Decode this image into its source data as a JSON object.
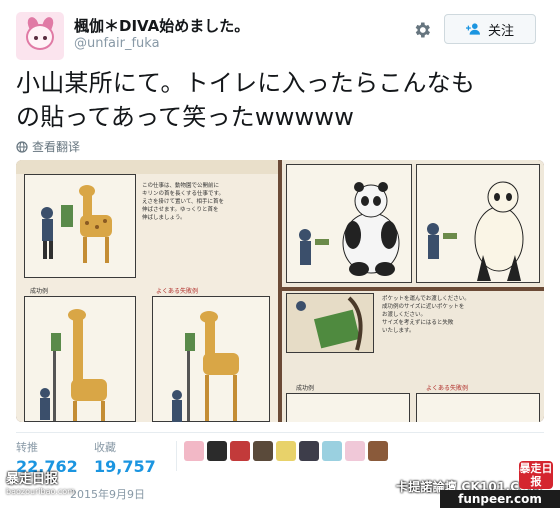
{
  "user": {
    "display_name": "楓伽＊DIVA始めました。",
    "handle": "@unfair_fuka"
  },
  "actions": {
    "follow_label": "关注",
    "settings_icon": "gear-icon",
    "follow_icon": "person-add-icon"
  },
  "tweet": {
    "text": "小山某所にて。トイレに入ったらこんなものの貼ってあって笑ったwwwww",
    "line1": "小山某所にて。トイレに入ったらこんなも",
    "line2": "の貼ってあって笑ったwwwww",
    "translate_label": "查看翻译"
  },
  "media": {
    "poster_lines": [
      "この仕事は、動物園で公開前に",
      "キリンの首を長くする仕事です。",
      "えさを掛けて置いて、相手に首を",
      "伸ばさせます。ゆっくりと首を",
      "伸ばしましょう。"
    ],
    "ok_label": "成功例",
    "ng_label": "よくある失敗例",
    "rb_lines": [
      "ポケットを運んでお渡しください。",
      "成功例のサイズに近いポケットを",
      "お渡しください。",
      "サイズを考えずにはると失敗",
      "いたします。"
    ]
  },
  "stats": {
    "retweets_label": "转推",
    "retweets_value": "22,762",
    "likes_label": "收藏",
    "likes_value": "19,757"
  },
  "likers": [
    "#f2b8c6",
    "#2b2b2b",
    "#c23a3a",
    "#5a4a3a",
    "#e8d26a",
    "#3d3d4a",
    "#9ad0e0",
    "#f0c8d8",
    "#8a5a3a"
  ],
  "timestamp": "2015年9月9日",
  "watermarks": {
    "left_big": "暴走日报",
    "left_small": "baozouribao.com",
    "mid": "卡提諾論壇 CK101.COM",
    "red_badge": "暴走日报",
    "bar": "funpeer.com"
  },
  "colors": {
    "link_blue": "#1b95e0",
    "muted": "#8899a6"
  }
}
